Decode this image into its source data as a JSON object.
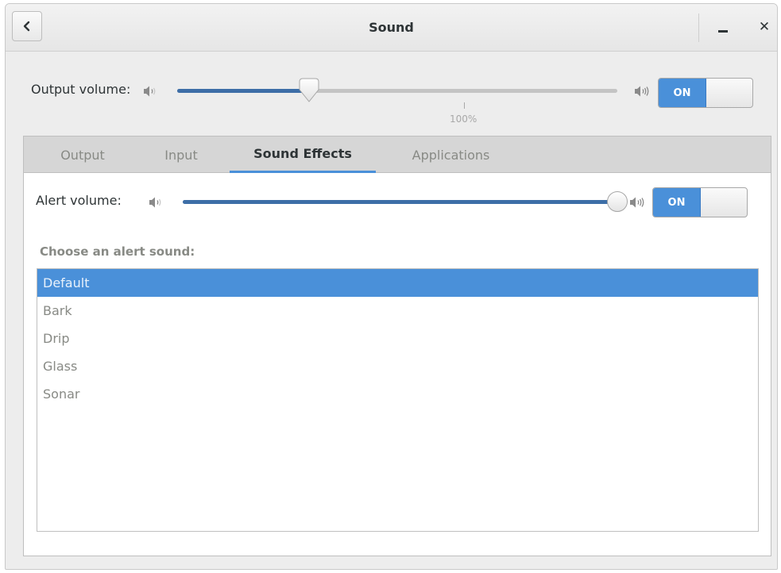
{
  "window": {
    "title": "Sound"
  },
  "output": {
    "label": "Output volume:",
    "volume_percent": 30,
    "tick_label": "100%",
    "switch_label": "ON"
  },
  "tabs": [
    "Output",
    "Input",
    "Sound Effects",
    "Applications"
  ],
  "active_tab": "Sound Effects",
  "alert": {
    "label": "Alert volume:",
    "volume_percent": 100,
    "switch_label": "ON"
  },
  "sounds": {
    "label": "Choose an alert sound:",
    "items": [
      "Default",
      "Bark",
      "Drip",
      "Glass",
      "Sonar"
    ],
    "selected": "Default"
  },
  "colors": {
    "accent": "#4a90d9",
    "slider_fill": "#3d6ea7"
  },
  "icons": {
    "back": "chevron-left-icon",
    "minimize": "minimize-icon",
    "close": "close-icon",
    "speaker_low": "speaker-low-icon",
    "speaker_high": "speaker-high-icon"
  }
}
